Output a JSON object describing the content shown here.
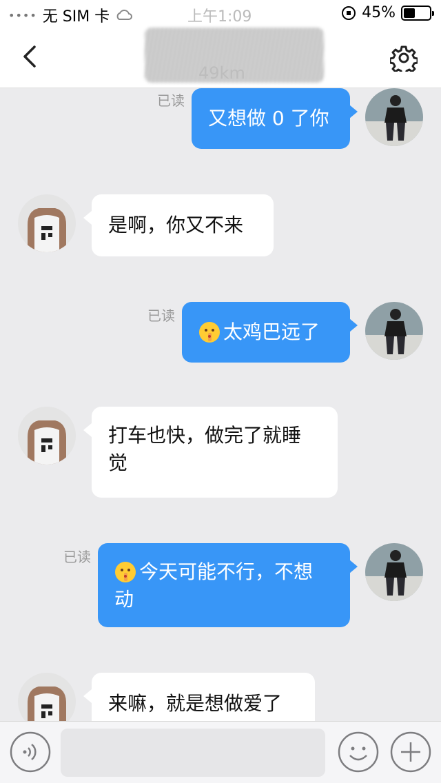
{
  "status_bar": {
    "signal": "••••",
    "carrier": "无 SIM 卡",
    "time": "上午1:09",
    "battery": "45%"
  },
  "header": {
    "distance": "49km"
  },
  "messages": [
    {
      "side": "out",
      "text": "又想做 0 了你",
      "read_label": "已读",
      "emoji": ""
    },
    {
      "side": "in",
      "text": "是啊，你又不来",
      "emoji": ""
    },
    {
      "side": "out",
      "text": "太鸡巴远了",
      "read_label": "已读",
      "emoji": "shush-face"
    },
    {
      "side": "in",
      "line1": "打车也快，做完了就睡",
      "line2": "觉",
      "emoji": ""
    },
    {
      "side": "out",
      "line1": "今天可能不行，不想",
      "line2": "动",
      "read_label": "已读",
      "emoji": "shush-face"
    },
    {
      "side": "in",
      "text": "来嘛，就是想做爱了",
      "emoji": ""
    }
  ],
  "input": {
    "value": "",
    "placeholder": ""
  },
  "colors": {
    "accent": "#3896f7",
    "background": "#ebebed"
  }
}
